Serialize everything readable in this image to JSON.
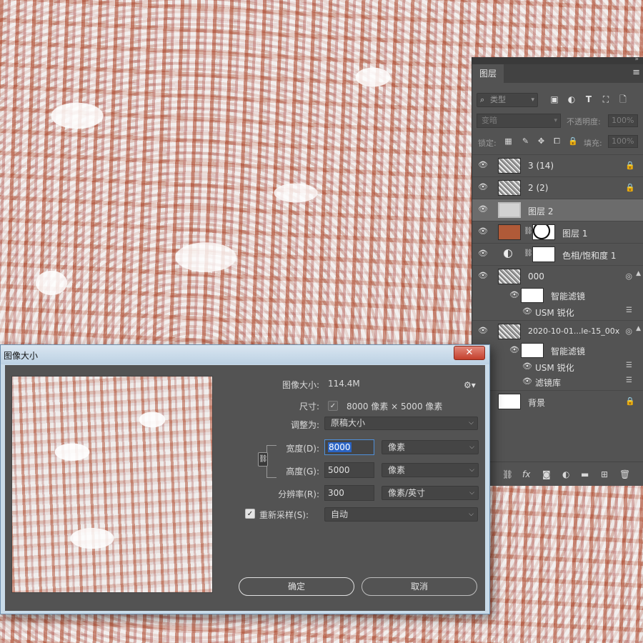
{
  "layers_panel": {
    "tab_label": "图层",
    "menu_icon": "≡",
    "collapse_icon": "»",
    "filter_kind_placeholder": "类型",
    "blend_mode": "变暗",
    "opacity_label": "不透明度:",
    "opacity_value": "100%",
    "lock_label": "锁定:",
    "fill_label": "填充:",
    "fill_value": "100%",
    "layers": [
      {
        "name": "3 (14)",
        "locked": true,
        "thumb": "noise"
      },
      {
        "name": "2 (2)",
        "locked": true,
        "thumb": "noise"
      },
      {
        "name": "图层 2",
        "selected": true,
        "thumb": "grey"
      },
      {
        "name": "图层 1",
        "thumb": "rust-with-mask"
      },
      {
        "name": "色相/饱和度 1",
        "thumb": "adjustment-mask"
      },
      {
        "name": "000",
        "thumb": "smart-object"
      },
      {
        "name": "智能滤镜",
        "type": "smart-filter-mask"
      },
      {
        "name": "USM 锐化",
        "type": "filter"
      },
      {
        "name": "2020-10-01...le-15_00x",
        "thumb": "smart-object"
      },
      {
        "name": "智能滤镜",
        "type": "smart-filter-mask"
      },
      {
        "name": "USM 锐化",
        "type": "filter"
      },
      {
        "name": "滤镜库",
        "type": "filter"
      },
      {
        "name": "背景",
        "locked": true,
        "thumb": "white"
      }
    ]
  },
  "dialog": {
    "title": "图像大小",
    "close_label": "✕",
    "image_size_label": "图像大小:",
    "image_size_value": "114.4M",
    "dimensions_label": "尺寸:",
    "dimensions_value": "8000 像素 × 5000 像素",
    "fit_to_label": "调整为:",
    "fit_to_value": "原稿大小",
    "width_label": "宽度(D):",
    "width_value": "8000",
    "width_unit": "像素",
    "height_label": "高度(G):",
    "height_value": "5000",
    "height_unit": "像素",
    "resolution_label": "分辨率(R):",
    "resolution_value": "300",
    "resolution_unit": "像素/英寸",
    "resample_label": "重新采样(S):",
    "resample_value": "自动",
    "resample_checked": true,
    "ok_label": "确定",
    "cancel_label": "取消"
  }
}
